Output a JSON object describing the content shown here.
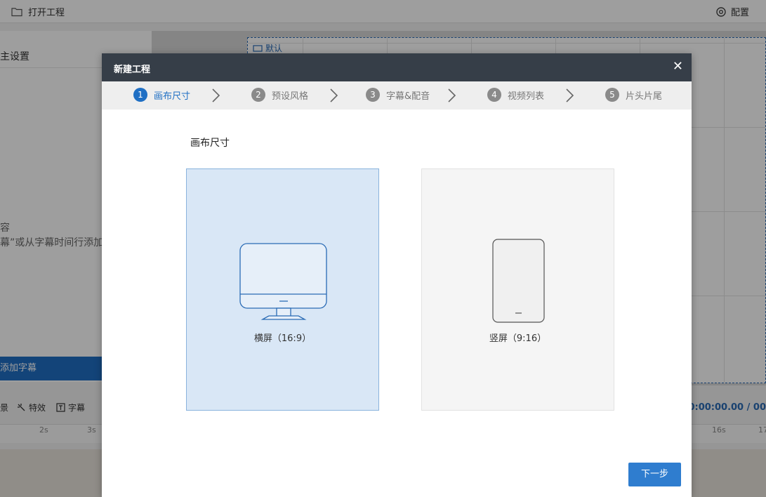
{
  "app": {
    "open_project": "打开工程",
    "config": "配置",
    "left_title": "主设置",
    "empty_line1": "容",
    "empty_line2": "幕”或从字幕时间行添加",
    "add_subtitle": "添加字幕",
    "canvas_default_tag": "默认",
    "tools": [
      {
        "label": "景",
        "icon": "scene-icon"
      },
      {
        "label": "特效",
        "icon": "effects-icon"
      },
      {
        "label": "字幕",
        "icon": "subtitle-icon"
      }
    ],
    "timecode": "00:00:00.00 / 00",
    "ruler_ticks": [
      "2s",
      "3s",
      "16s",
      "17"
    ],
    "colors": {
      "accent": "#1f6fc4",
      "header": "#363e48"
    }
  },
  "modal": {
    "title": "新建工程",
    "close_icon": "close-icon",
    "steps": [
      {
        "num": "1",
        "label": "画布尺寸",
        "active": true
      },
      {
        "num": "2",
        "label": "预设风格",
        "active": false
      },
      {
        "num": "3",
        "label": "字幕&配音",
        "active": false
      },
      {
        "num": "4",
        "label": "视频列表",
        "active": false
      },
      {
        "num": "5",
        "label": "片头片尾",
        "active": false
      }
    ],
    "section_title": "画布尺寸",
    "options": [
      {
        "label": "横屏（16:9）",
        "icon": "monitor-icon",
        "selected": true
      },
      {
        "label": "竖屏（9:16）",
        "icon": "phone-icon",
        "selected": false
      }
    ],
    "next": "下一步"
  }
}
